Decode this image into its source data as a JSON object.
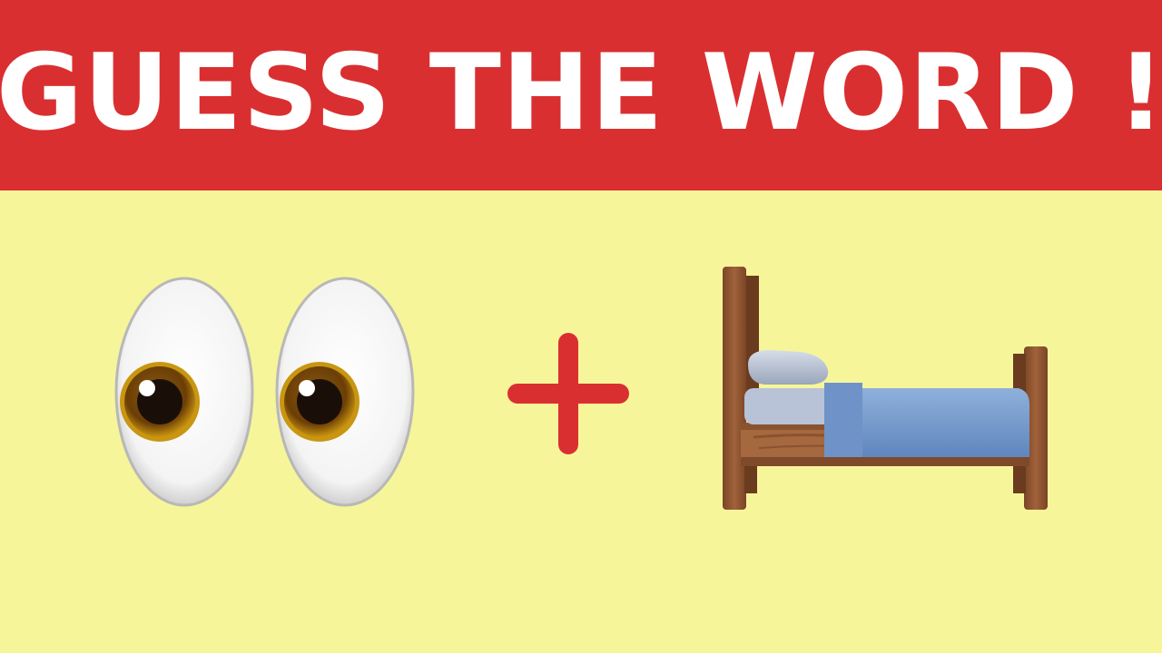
{
  "header": {
    "title": "GUESS THE WORD !",
    "background_color": "#DA2F30",
    "text_color": "#FFFFFF"
  },
  "page": {
    "background_color": "#F7F59A"
  },
  "puzzle": {
    "items": [
      {
        "icon": "eyes-emoji"
      },
      {
        "icon": "plus-sign"
      },
      {
        "icon": "bed-emoji"
      }
    ],
    "plus_color": "#DA2F30"
  }
}
